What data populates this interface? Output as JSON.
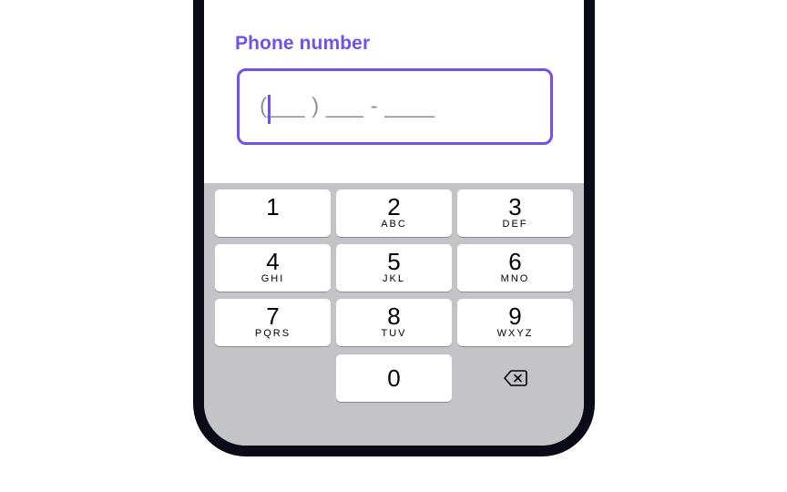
{
  "field": {
    "label": "Phone number",
    "value": "(___ ) ___ - ____"
  },
  "keypad": {
    "keys": [
      {
        "digit": "1",
        "letters": ""
      },
      {
        "digit": "2",
        "letters": "ABC"
      },
      {
        "digit": "3",
        "letters": "DEF"
      },
      {
        "digit": "4",
        "letters": "GHI"
      },
      {
        "digit": "5",
        "letters": "JKL"
      },
      {
        "digit": "6",
        "letters": "MNO"
      },
      {
        "digit": "7",
        "letters": "PQRS"
      },
      {
        "digit": "8",
        "letters": "TUV"
      },
      {
        "digit": "9",
        "letters": "WXYZ"
      },
      {
        "digit": "0",
        "letters": ""
      }
    ],
    "delete_icon": "delete-backspace-icon"
  },
  "colors": {
    "accent": "#7350ea",
    "keyboard_bg": "#c4c4c8",
    "frame": "#0b0b17"
  }
}
